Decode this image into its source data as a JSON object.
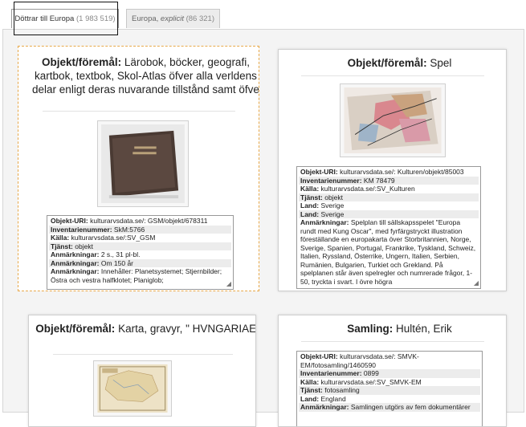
{
  "tabs": [
    {
      "label": "Döttrar till Europa",
      "count": "(1 983 519)",
      "active": true
    },
    {
      "label_plain": "Europa, ",
      "label_em": "explicit",
      "count": "(86 321)",
      "active": false
    }
  ],
  "cards": [
    {
      "title_label": "Objekt/föremål:",
      "title_value": "Lärobok, böcker, geografi, kartbok, textbok, Skol-Atlas öfver alla verldens delar enligt deras nuvarande tillstånd samt öfve",
      "image": "book-atlas-image",
      "fields": [
        {
          "label": "Objekt-URI:",
          "value": "kulturarvsdata.se/: GSM/objekt/678311"
        },
        {
          "label": "Inventarienummer:",
          "value": "SkM:5766"
        },
        {
          "label": "Källa:",
          "value": "kulturarvsdata.se/:SV_GSM"
        },
        {
          "label": "Tjänst:",
          "value": "objekt"
        },
        {
          "label": "Anmärkningar:",
          "value": "2 s., 31 pl-bl."
        },
        {
          "label": "Anmärkningar:",
          "value": "Om 150 år"
        },
        {
          "label": "Anmärkningar:",
          "value": "Innehåller: Planetsystemet; Stjernbilder; Östra och vestra halfklotet; Planiglob;"
        }
      ]
    },
    {
      "title_label": "Objekt/föremål:",
      "title_value": "Spel",
      "image": "game-map-image",
      "fields": [
        {
          "label": "Objekt-URI:",
          "value": "kulturarvsdata.se/: Kulturen/objekt/85003"
        },
        {
          "label": "Inventarienummer:",
          "value": "KM 78479"
        },
        {
          "label": "Källa:",
          "value": "kulturarvsdata.se/:SV_Kulturen"
        },
        {
          "label": "Tjänst:",
          "value": "objekt"
        },
        {
          "label": "Land:",
          "value": "Sverige"
        },
        {
          "label": "Land:",
          "value": "Sverige"
        },
        {
          "label": "Anmärkningar:",
          "value": "Spelplan till sällskapsspelet \"Europa rundt med Kung Oscar\", med fyrfärgstryckt illustration föreställande en europakarta över Storbritannien, Norge, Sverige, Spanien, Portugal, Frankrike, Tyskland, Schweiz, Italien, Ryssland, Österrike, Ungern, Italien, Serbien, Rumänien, Bulgarien, Turkiet och Grekland. På spelplanen står även spelregler och numrerade frågor, 1-50, tryckta i svart. I övre högra"
        }
      ]
    },
    {
      "title_label": "Objekt/föremål:",
      "title_value": "Karta, gravyr, \" HVNGARIAE \"",
      "image": "hungary-map-image",
      "fields": []
    },
    {
      "title_label": "Samling:",
      "title_value": "Hultén, Erik",
      "image": "",
      "fields": [
        {
          "label": "Objekt-URI:",
          "value": "kulturarvsdata.se/: SMVK-EM/fotosamling/1460590"
        },
        {
          "label": "Inventarienummer:",
          "value": "0899"
        },
        {
          "label": "Källa:",
          "value": "kulturarvsdata.se/:SV_SMVK-EM"
        },
        {
          "label": "Tjänst:",
          "value": "fotosamling"
        },
        {
          "label": "Land:",
          "value": "England"
        },
        {
          "label": "Anmärkningar:",
          "value": "Samlingen utgörs av fem dokumentärer"
        }
      ]
    }
  ],
  "icons": {
    "resize_grip": "◢"
  }
}
